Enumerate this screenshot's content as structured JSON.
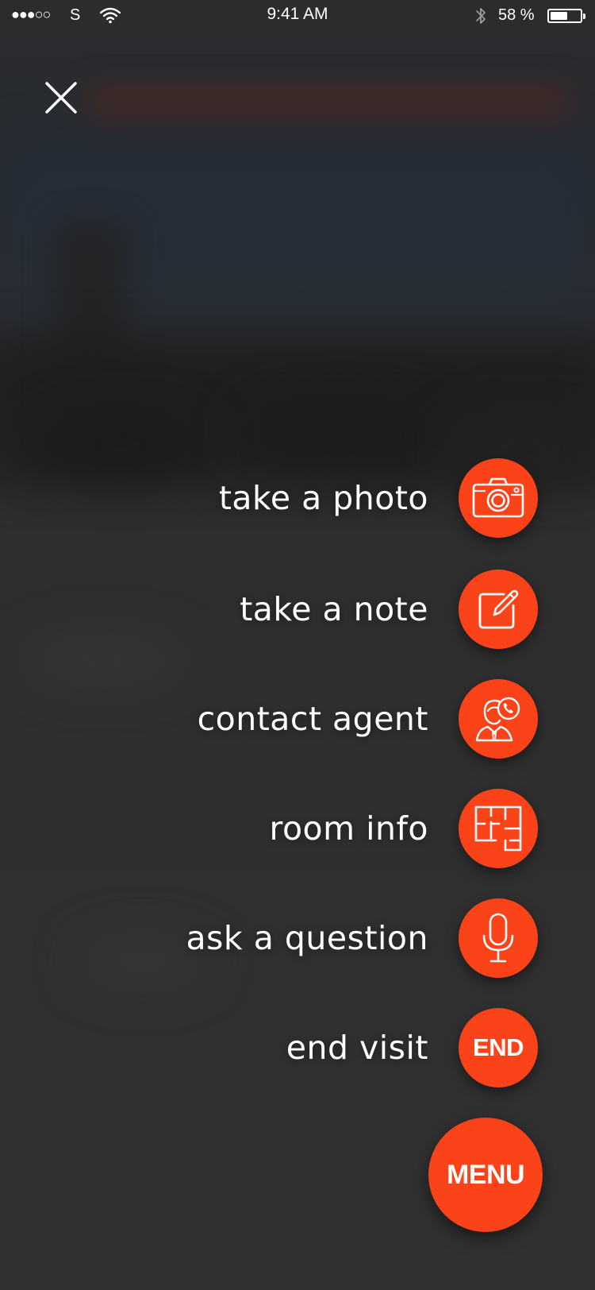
{
  "status_bar": {
    "signal": "●●●○○",
    "carrier": "S",
    "time": "9:41 AM",
    "battery_percent": "58 %",
    "battery_level": 0.58,
    "icons": [
      "signal-dots-icon",
      "wifi-icon",
      "bluetooth-icon",
      "battery-icon"
    ]
  },
  "close_icon": "close-icon",
  "menu": {
    "items": [
      {
        "label": "take a photo",
        "icon": "camera-icon"
      },
      {
        "label": "take a note",
        "icon": "note-edit-icon"
      },
      {
        "label": "contact agent",
        "icon": "agent-phone-icon"
      },
      {
        "label": "room info",
        "icon": "floor-plan-icon"
      },
      {
        "label": "ask a question",
        "icon": "microphone-icon"
      },
      {
        "label": "end visit",
        "icon_text": "END"
      }
    ],
    "fab_label": "MENU"
  },
  "colors": {
    "accent": "#fa4318",
    "overlay": "#2f2f2f",
    "text": "#ffffff"
  }
}
